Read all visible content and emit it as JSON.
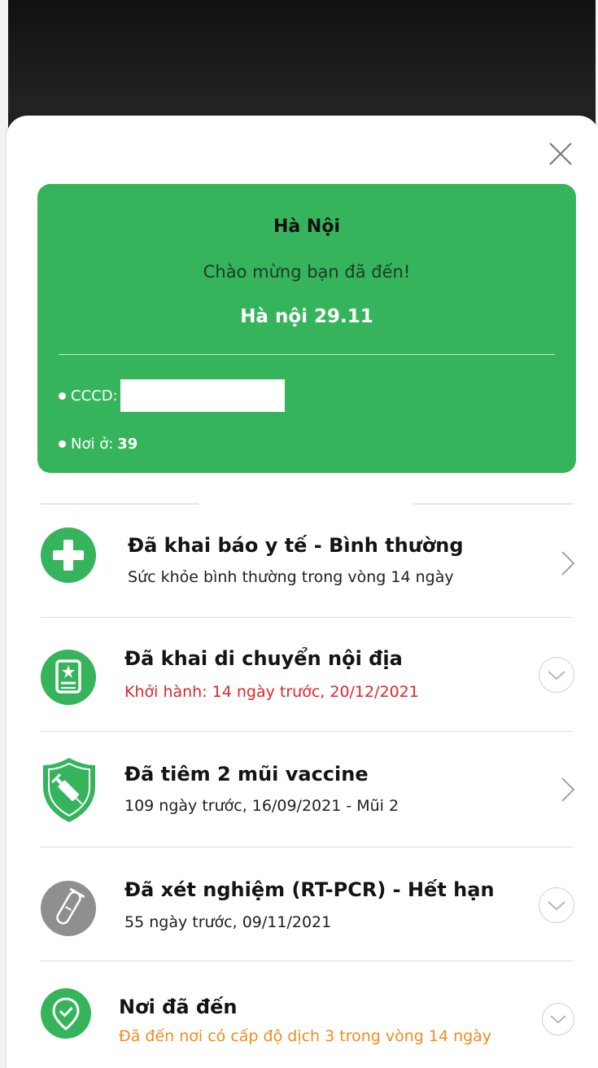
{
  "card": {
    "city": "Hà Nội",
    "welcome": "Chào mừng bạn đã đến!",
    "place_name": "Hà nội 29.11",
    "id_label": "CCCD:",
    "residence_label": "Nơi ở:",
    "residence_value": "39",
    "background_color": "#36b45c"
  },
  "items": [
    {
      "title": "Đã khai báo y tế - Bình thường",
      "subtitle": "Sức khỏe bình thường trong vòng 14 ngày",
      "icon": "medical-plus-icon",
      "chevron": "chevron-right-icon"
    },
    {
      "title": "Đã khai di chuyển nội địa",
      "subtitle": "Khởi hành: 14 ngày trước, 20/12/2021",
      "subtitle_color": "#e0262b",
      "icon": "travel-document-icon",
      "chevron": "chevron-down-icon"
    },
    {
      "title": "Đã tiêm 2 mũi vaccine",
      "subtitle": "109 ngày trước, 16/09/2021 - Mũi 2",
      "icon": "vaccine-shield-icon",
      "chevron": "chevron-right-icon"
    },
    {
      "title": "Đã xét nghiệm (RT-PCR) - Hết hạn",
      "subtitle": "55 ngày trước, 09/11/2021",
      "icon": "test-tube-icon",
      "chevron": "chevron-down-icon"
    },
    {
      "title": "Nơi đã đến",
      "subtitle": "Đã đến nơi có cấp độ dịch 3 trong vòng 14 ngày",
      "subtitle_color": "#f28b1e",
      "icon": "location-check-icon",
      "chevron": "chevron-down-icon"
    }
  ]
}
